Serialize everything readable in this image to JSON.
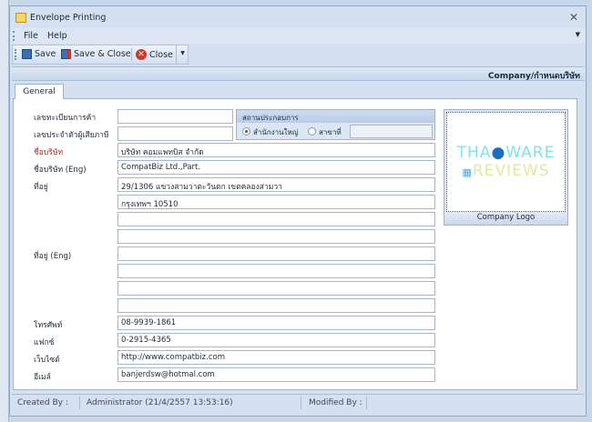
{
  "window": {
    "title": "Envelope Printing"
  },
  "menu": [
    "File",
    "Help"
  ],
  "toolbar": {
    "save": "Save",
    "save_close": "Save & Close",
    "close": "Close"
  },
  "header": {
    "title": "Company/กำหนดบริษัท"
  },
  "tabs": [
    {
      "label": "General",
      "active": true
    }
  ],
  "form": {
    "trade_reg_label": "เลขทะเบียนการค้า",
    "trade_reg_value": "",
    "tax_id_label": "เลขประจำตัวผู้เสียภาษี",
    "tax_id_value": "",
    "establishment": {
      "title": "สถานประกอบการ",
      "head_office": "สำนักงานใหญ่",
      "branch": "สาขาที่",
      "branch_value": "",
      "selected": "head_office"
    },
    "name_label": "ชื่อบริษัท",
    "name_value": "บริษัท คอมแพทบิส จำกัด",
    "name_eng_label": "ชื่อบริษัท (Eng)",
    "name_eng_value": "CompatBiz Ltd.,Part.",
    "address_label": "ที่อยู่",
    "address": [
      "29/1306 แขวงสามวาตะวันตก เขตคลองสามวา",
      "กรุงเทพฯ 10510",
      "",
      ""
    ],
    "address_eng_label": "ที่อยู่ (Eng)",
    "address_eng": [
      "",
      "",
      "",
      ""
    ],
    "phone_label": "โทรศัพท์",
    "phone_value": "08-9939-1861",
    "fax_label": "แฟกซ์",
    "fax_value": "0-2915-4365",
    "website_label": "เว็บไซต์",
    "website_value": "http://www.compatbiz.com",
    "email_label": "อีเมล์",
    "email_value": "banjerdsw@hotmal.com"
  },
  "logo": {
    "caption": "Company Logo",
    "text_top": "THAIWARE",
    "text_bottom": "REVIEWS"
  },
  "status": {
    "created_label": "Created By :",
    "created_value": "Administrator (21/4/2557 13:53:16)",
    "modified_label": "Modified By :"
  }
}
